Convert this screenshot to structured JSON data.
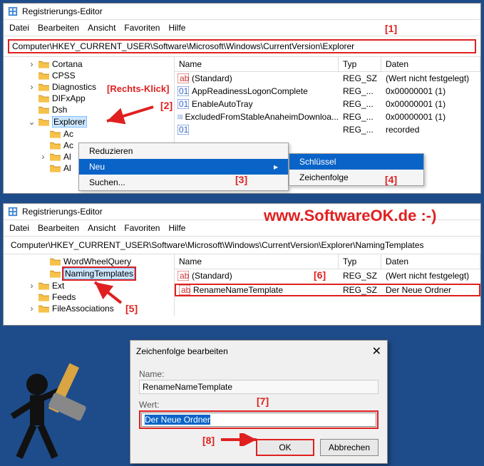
{
  "watermark": "www.SoftwareOK.de :-)",
  "markers": {
    "m1": "[1]",
    "m2": "[2]",
    "m3": "[3]",
    "m4": "[4]",
    "m5": "[5]",
    "m6": "[6]",
    "m7": "[7]",
    "m8": "[8]"
  },
  "rechtsklick": "[Rechts-Klick]",
  "win": {
    "title": "Registrierungs-Editor",
    "menu": {
      "datei": "Datei",
      "bearbeiten": "Bearbeiten",
      "ansicht": "Ansicht",
      "favoriten": "Favoriten",
      "hilfe": "Hilfe"
    }
  },
  "upper": {
    "address": "Computer\\HKEY_CURRENT_USER\\Software\\Microsoft\\Windows\\CurrentVersion\\Explorer",
    "tree": {
      "items": [
        {
          "chev": "›",
          "name": "Cortana"
        },
        {
          "chev": "",
          "name": "CPSS"
        },
        {
          "chev": "›",
          "name": "Diagnostics"
        },
        {
          "chev": "",
          "name": "DIFxApp"
        },
        {
          "chev": "",
          "name": "Dsh"
        },
        {
          "chev": "⌄",
          "name": "Explorer",
          "selected": true
        },
        {
          "chev": "",
          "name": "Ac",
          "indent": 1
        },
        {
          "chev": "",
          "name": "Ac",
          "indent": 1
        },
        {
          "chev": "›",
          "name": "Al",
          "indent": 1
        },
        {
          "chev": "",
          "name": "Al",
          "indent": 1
        }
      ]
    },
    "list": {
      "cols": {
        "name": "Name",
        "typ": "Typ",
        "daten": "Daten"
      },
      "rows": [
        {
          "ico": "sz",
          "name": "(Standard)",
          "typ": "REG_SZ",
          "data": "(Wert nicht festgelegt)"
        },
        {
          "ico": "dw",
          "name": "AppReadinessLogonComplete",
          "typ": "REG_...",
          "data": "0x00000001 (1)"
        },
        {
          "ico": "dw",
          "name": "EnableAutoTray",
          "typ": "REG_...",
          "data": "0x00000001 (1)"
        },
        {
          "ico": "dw",
          "name": "ExcludedFromStableAnaheimDownloa...",
          "typ": "REG_...",
          "data": "0x00000001 (1)"
        },
        {
          "ico": "dw",
          "name": "",
          "typ": "REG_...",
          "data": "recorded"
        }
      ]
    },
    "ctx": {
      "reduzieren": "Reduzieren",
      "neu": "Neu",
      "suchen": "Suchen...",
      "sub": {
        "schluessel": "Schlüssel",
        "zeichenfolge": "Zeichenfolge"
      }
    }
  },
  "lower": {
    "address": "Computer\\HKEY_CURRENT_USER\\Software\\Microsoft\\Windows\\CurrentVersion\\Explorer\\NamingTemplates",
    "tree": {
      "items": [
        {
          "chev": "",
          "name": "WordWheelQuery",
          "indent": 1
        },
        {
          "chev": "",
          "name": "NamingTemplates",
          "indent": 1,
          "selected": true,
          "boxed": true
        },
        {
          "chev": "›",
          "name": "Ext"
        },
        {
          "chev": "",
          "name": "Feeds"
        },
        {
          "chev": "›",
          "name": "FileAssociations"
        }
      ]
    },
    "list": {
      "cols": {
        "name": "Name",
        "typ": "Typ",
        "daten": "Daten"
      },
      "rows": [
        {
          "ico": "sz",
          "name": "(Standard)",
          "typ": "REG_SZ",
          "data": "(Wert nicht festgelegt)"
        },
        {
          "ico": "sz",
          "name": "RenameNameTemplate",
          "typ": "REG_SZ",
          "data": "Der Neue Ordner",
          "sel": true
        }
      ]
    }
  },
  "dialog": {
    "title": "Zeichenfolge bearbeiten",
    "nameLabel": "Name:",
    "nameValue": "RenameNameTemplate",
    "wertLabel": "Wert:",
    "wertValue": "Der Neue Ordner",
    "ok": "OK",
    "cancel": "Abbrechen"
  }
}
